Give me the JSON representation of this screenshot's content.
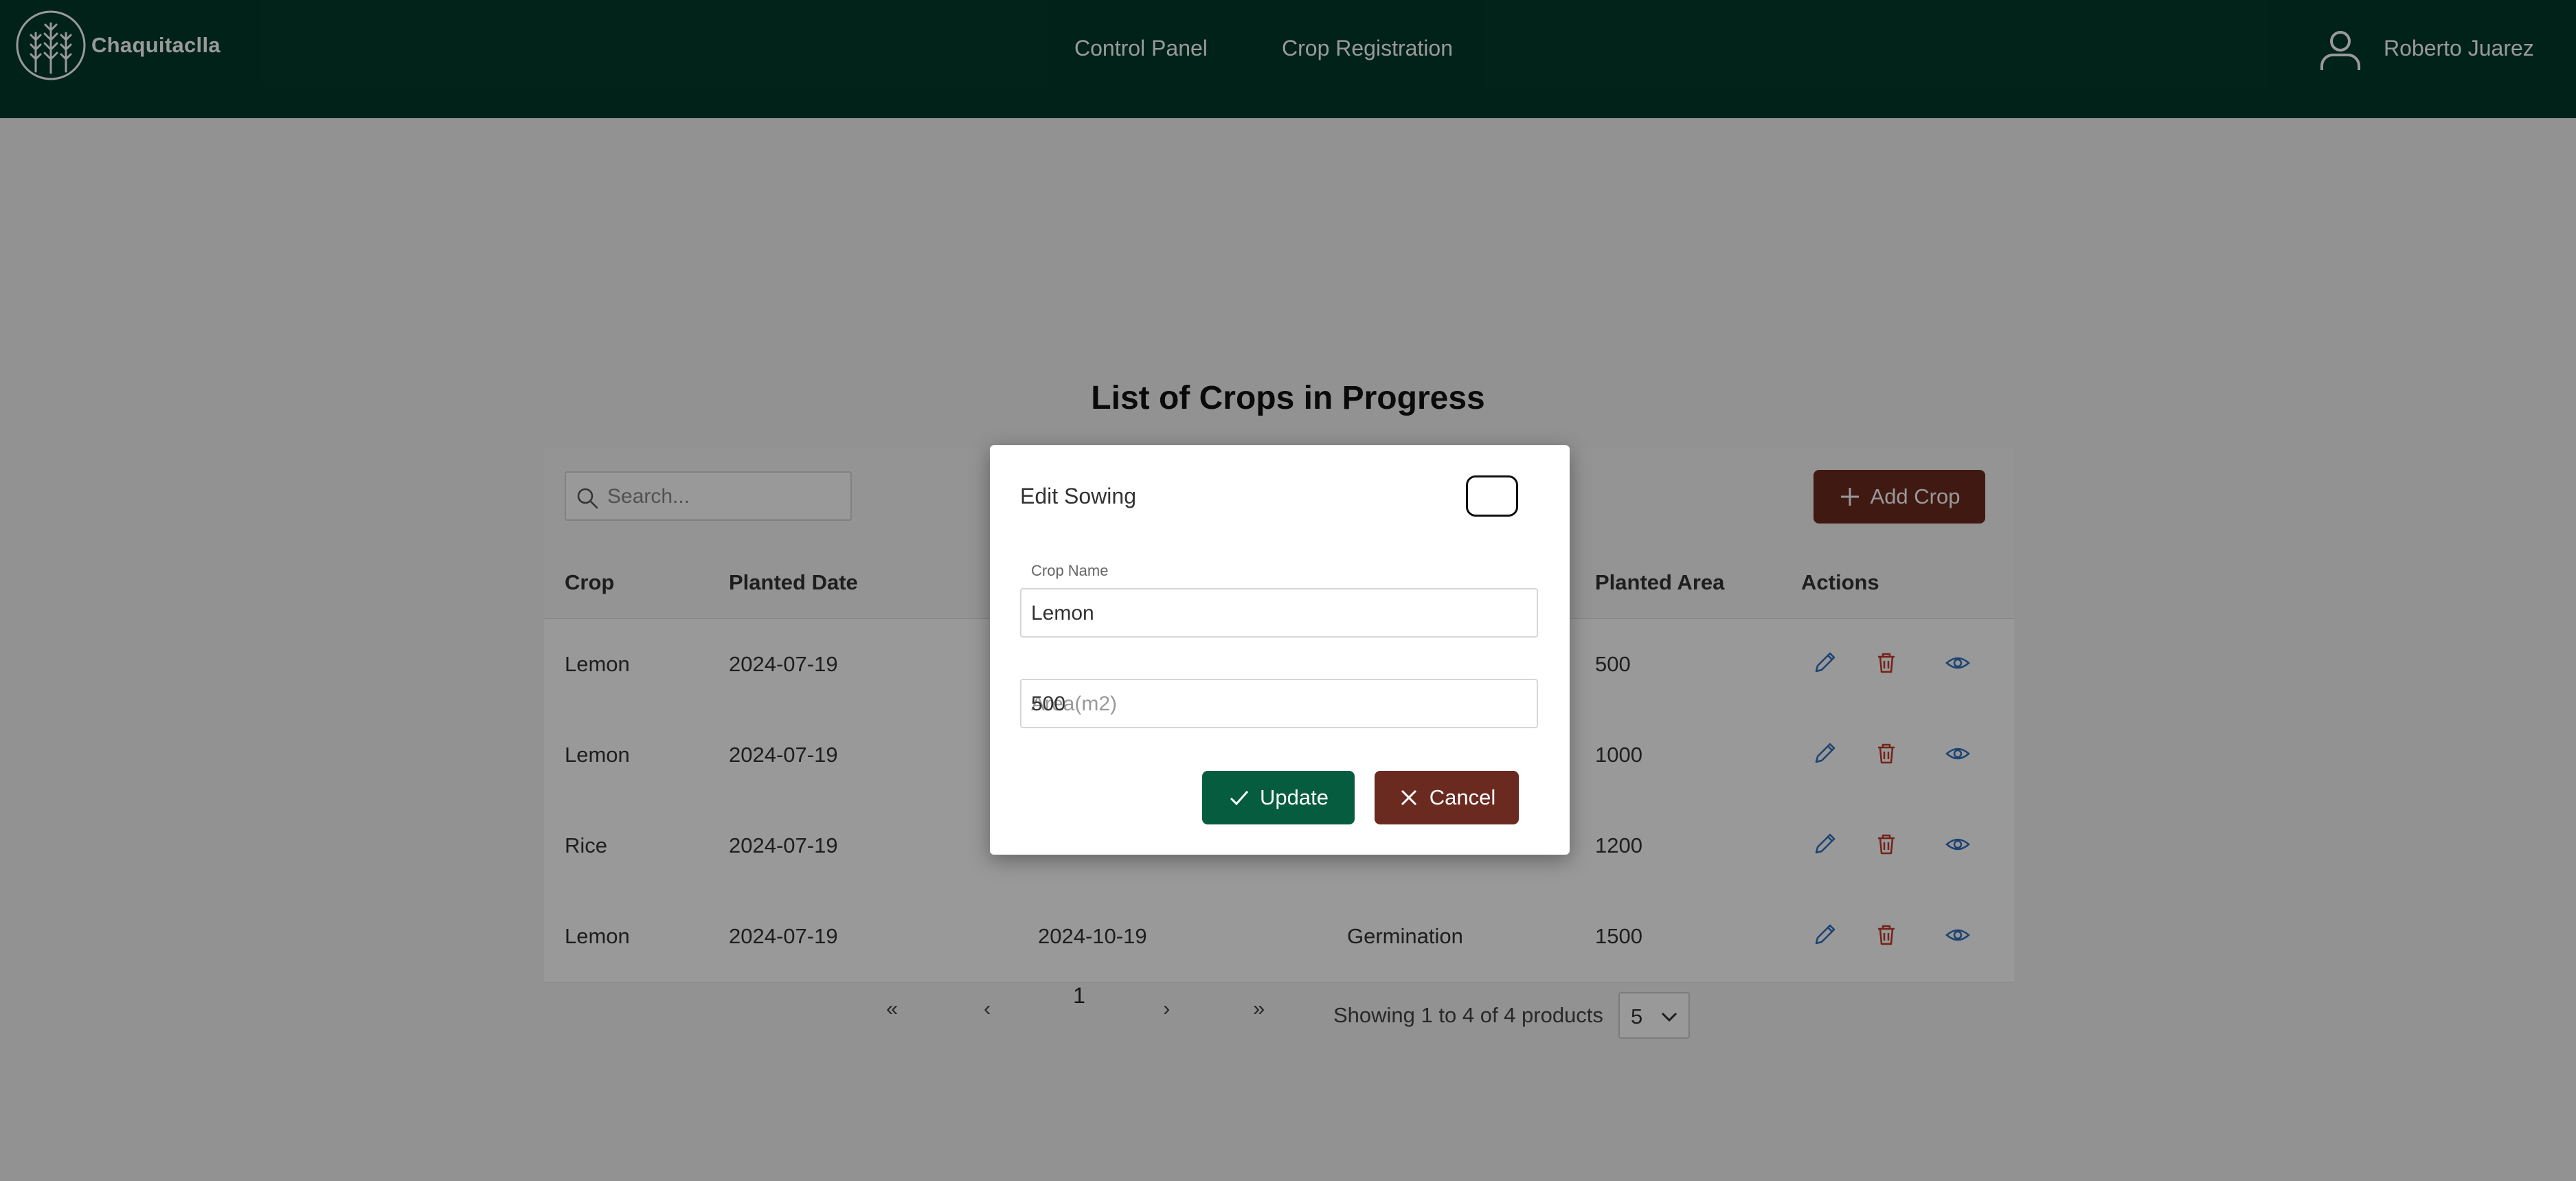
{
  "header": {
    "brand": "Chaquitaclla",
    "nav": [
      "Control Panel",
      "Crop Registration"
    ],
    "user_name": "Roberto Juarez",
    "logo_icon": "wheat-logo-icon",
    "user_icon": "user-icon",
    "background": "#013a2a"
  },
  "page": {
    "title": "List of Crops in Progress"
  },
  "toolbar": {
    "search_placeholder": "Search...",
    "add_label": "Add Crop",
    "add_color": "#6b2a20"
  },
  "table": {
    "columns": [
      "Crop",
      "Planted Date",
      "",
      "",
      "Planted Area",
      "Actions"
    ],
    "rows": [
      [
        "Lemon",
        "2024-07-19",
        "",
        "",
        "500"
      ],
      [
        "Lemon",
        "2024-07-19",
        "",
        "",
        "1000"
      ],
      [
        "Rice",
        "2024-07-19",
        "",
        "",
        "1200"
      ],
      [
        "Lemon",
        "2024-07-19",
        "2024-10-19",
        "Germination",
        "1500"
      ]
    ],
    "action_icons": [
      "edit-icon",
      "delete-icon",
      "view-icon"
    ]
  },
  "pagination": {
    "current_page": "1",
    "summary": "Showing 1 to 4 of 4 products",
    "rows_per_page": "5"
  },
  "modal": {
    "title": "Edit Sowing",
    "crop_name_label": "Crop Name",
    "crop_name_value": "Lemon",
    "area_value": "500",
    "area_placeholder": "Area(m2)",
    "update_label": "Update",
    "cancel_label": "Cancel",
    "update_color": "#055c3f",
    "cancel_color": "#6b2a20"
  }
}
